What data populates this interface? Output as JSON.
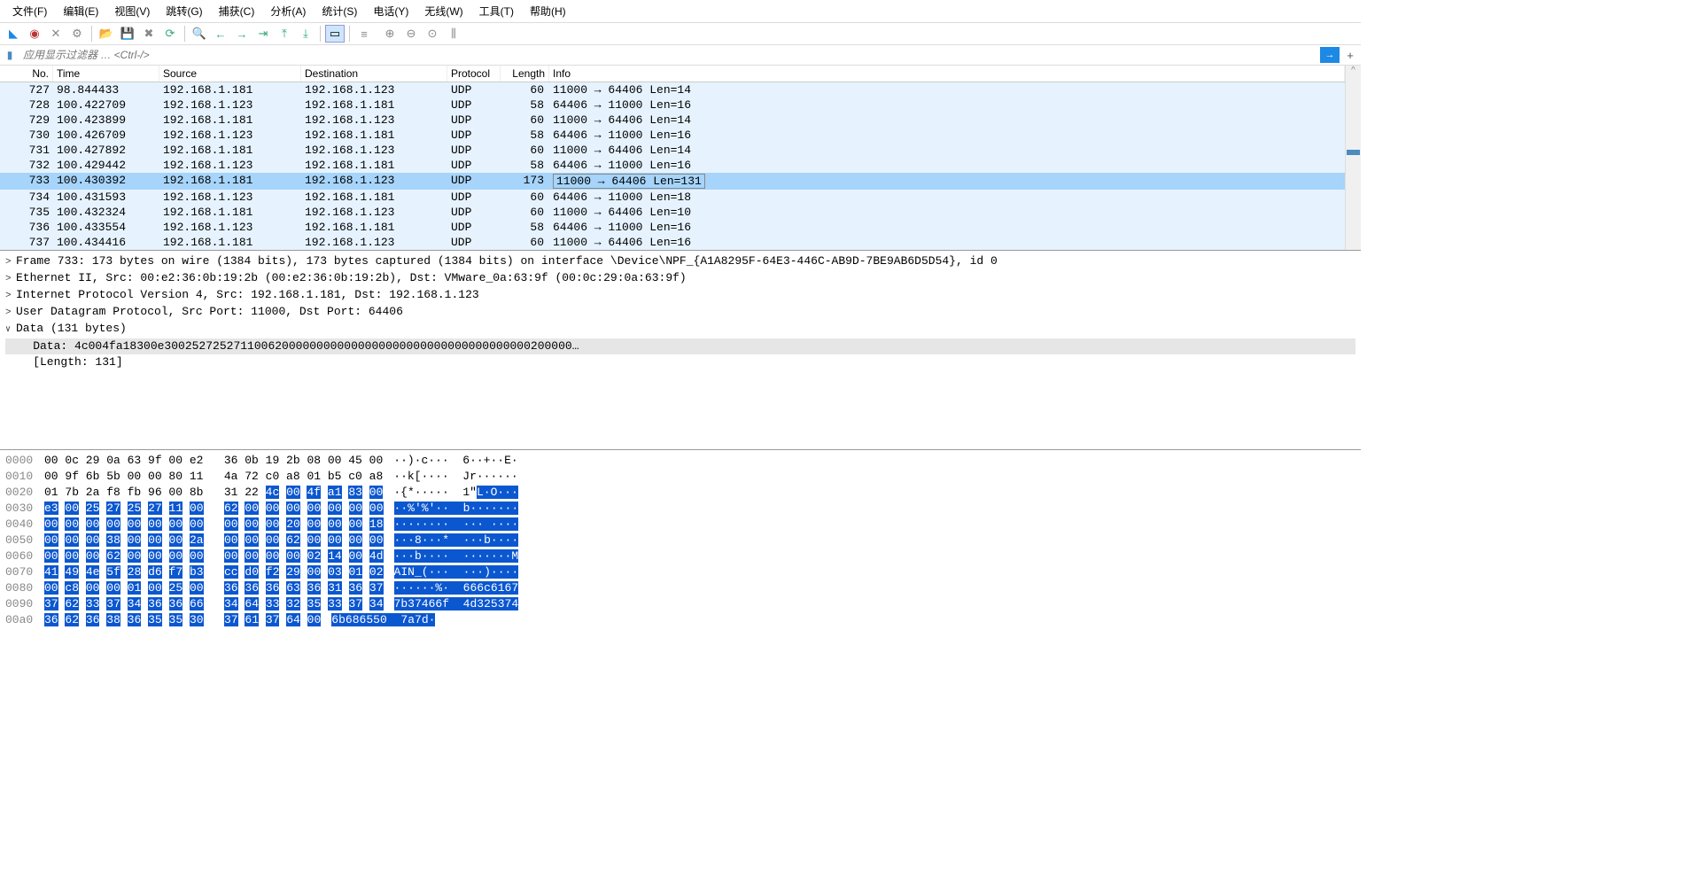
{
  "menu": {
    "file": "文件(F)",
    "edit": "编辑(E)",
    "view": "视图(V)",
    "go": "跳转(G)",
    "capture": "捕获(C)",
    "analyze": "分析(A)",
    "statistics": "统计(S)",
    "telephony": "电话(Y)",
    "wireless": "无线(W)",
    "tools": "工具(T)",
    "help": "帮助(H)"
  },
  "filter": {
    "placeholder": "应用显示过滤器 … <Ctrl-/>",
    "arrow": "→",
    "plus": "+"
  },
  "columns": [
    "No.",
    "Time",
    "Source",
    "Destination",
    "Protocol",
    "Length",
    "Info"
  ],
  "packets": [
    {
      "no": "727",
      "time": "98.844433",
      "src": "192.168.1.181",
      "dst": "192.168.1.123",
      "proto": "UDP",
      "len": "60",
      "info": "11000 → 64406 Len=14",
      "sel": false
    },
    {
      "no": "728",
      "time": "100.422709",
      "src": "192.168.1.123",
      "dst": "192.168.1.181",
      "proto": "UDP",
      "len": "58",
      "info": "64406 → 11000 Len=16",
      "sel": false
    },
    {
      "no": "729",
      "time": "100.423899",
      "src": "192.168.1.181",
      "dst": "192.168.1.123",
      "proto": "UDP",
      "len": "60",
      "info": "11000 → 64406 Len=14",
      "sel": false
    },
    {
      "no": "730",
      "time": "100.426709",
      "src": "192.168.1.123",
      "dst": "192.168.1.181",
      "proto": "UDP",
      "len": "58",
      "info": "64406 → 11000 Len=16",
      "sel": false
    },
    {
      "no": "731",
      "time": "100.427892",
      "src": "192.168.1.181",
      "dst": "192.168.1.123",
      "proto": "UDP",
      "len": "60",
      "info": "11000 → 64406 Len=14",
      "sel": false
    },
    {
      "no": "732",
      "time": "100.429442",
      "src": "192.168.1.123",
      "dst": "192.168.1.181",
      "proto": "UDP",
      "len": "58",
      "info": "64406 → 11000 Len=16",
      "sel": false
    },
    {
      "no": "733",
      "time": "100.430392",
      "src": "192.168.1.181",
      "dst": "192.168.1.123",
      "proto": "UDP",
      "len": "173",
      "info": "11000 → 64406 Len=131",
      "sel": true
    },
    {
      "no": "734",
      "time": "100.431593",
      "src": "192.168.1.123",
      "dst": "192.168.1.181",
      "proto": "UDP",
      "len": "60",
      "info": "64406 → 11000 Len=18",
      "sel": false
    },
    {
      "no": "735",
      "time": "100.432324",
      "src": "192.168.1.181",
      "dst": "192.168.1.123",
      "proto": "UDP",
      "len": "60",
      "info": "11000 → 64406 Len=10",
      "sel": false
    },
    {
      "no": "736",
      "time": "100.433554",
      "src": "192.168.1.123",
      "dst": "192.168.1.181",
      "proto": "UDP",
      "len": "58",
      "info": "64406 → 11000 Len=16",
      "sel": false
    },
    {
      "no": "737",
      "time": "100.434416",
      "src": "192.168.1.181",
      "dst": "192.168.1.123",
      "proto": "UDP",
      "len": "60",
      "info": "11000 → 64406 Len=16",
      "sel": false
    }
  ],
  "details": {
    "frame": "Frame 733: 173 bytes on wire (1384 bits), 173 bytes captured (1384 bits) on interface \\Device\\NPF_{A1A8295F-64E3-446C-AB9D-7BE9AB6D5D54}, id 0",
    "eth": "Ethernet II, Src: 00:e2:36:0b:19:2b (00:e2:36:0b:19:2b), Dst: VMware_0a:63:9f (00:0c:29:0a:63:9f)",
    "ip": "Internet Protocol Version 4, Src: 192.168.1.181, Dst: 192.168.1.123",
    "udp": "User Datagram Protocol, Src Port: 11000, Dst Port: 64406",
    "data_hdr": "Data (131 bytes)",
    "data_val": "    Data: 4c004fa18300e30025272527110062000000000000000000000000000000000000200000…",
    "data_len": "    [Length: 131]"
  },
  "hex": [
    {
      "off": "0000",
      "b1": "00 0c 29 0a 63 9f 00 e2",
      "b2": "36 0b 19 2b 08 00 45 00",
      "a": "··)·c···  6··+··E·",
      "hs": 99,
      "he": 99,
      "as": 99,
      "ae": 99
    },
    {
      "off": "0010",
      "b1": "00 9f 6b 5b 00 00 80 11",
      "b2": "4a 72 c0 a8 01 b5 c0 a8",
      "a": "··k[····  Jr······",
      "hs": 99,
      "he": 99,
      "as": 99,
      "ae": 99
    },
    {
      "off": "0020",
      "b1": "01 7b 2a f8 fb 96 00 8b",
      "b2": "31 22 4c 00 4f a1 83 00",
      "a": "·{*·····  1\"L·O···",
      "hs": 10,
      "he": 16,
      "as": 12,
      "ae": 18
    },
    {
      "off": "0030",
      "b1": "e3 00 25 27 25 27 11 00",
      "b2": "62 00 00 00 00 00 00 00",
      "a": "··%'%'··  b·······",
      "hs": 0,
      "he": 16,
      "as": 0,
      "ae": 18
    },
    {
      "off": "0040",
      "b1": "00 00 00 00 00 00 00 00",
      "b2": "00 00 00 20 00 00 00 18",
      "a": "········  ··· ····",
      "hs": 0,
      "he": 16,
      "as": 0,
      "ae": 18
    },
    {
      "off": "0050",
      "b1": "00 00 00 38 00 00 00 2a",
      "b2": "00 00 00 62 00 00 00 00",
      "a": "···8···*  ···b····",
      "hs": 0,
      "he": 16,
      "as": 0,
      "ae": 18
    },
    {
      "off": "0060",
      "b1": "00 00 00 62 00 00 00 00",
      "b2": "00 00 00 00 02 14 00 4d",
      "a": "···b····  ·······M",
      "hs": 0,
      "he": 16,
      "as": 0,
      "ae": 18
    },
    {
      "off": "0070",
      "b1": "41 49 4e 5f 28 d6 f7 b3",
      "b2": "cc d0 f2 29 00 03 01 02",
      "a": "AIN_(···  ···)····",
      "hs": 0,
      "he": 16,
      "as": 0,
      "ae": 18
    },
    {
      "off": "0080",
      "b1": "00 c8 00 00 01 00 25 00",
      "b2": "36 36 36 63 36 31 36 37",
      "a": "······%·  666c6167",
      "hs": 0,
      "he": 16,
      "as": 0,
      "ae": 18
    },
    {
      "off": "0090",
      "b1": "37 62 33 37 34 36 36 66",
      "b2": "34 64 33 32 35 33 37 34",
      "a": "7b37466f  4d325374",
      "hs": 0,
      "he": 16,
      "as": 0,
      "ae": 18
    },
    {
      "off": "00a0",
      "b1": "36 62 36 38 36 35 35 30",
      "b2": "37 61 37 64 00",
      "a": "6b686550  7a7d·",
      "hs": 0,
      "he": 13,
      "as": 0,
      "ae": 15
    }
  ]
}
